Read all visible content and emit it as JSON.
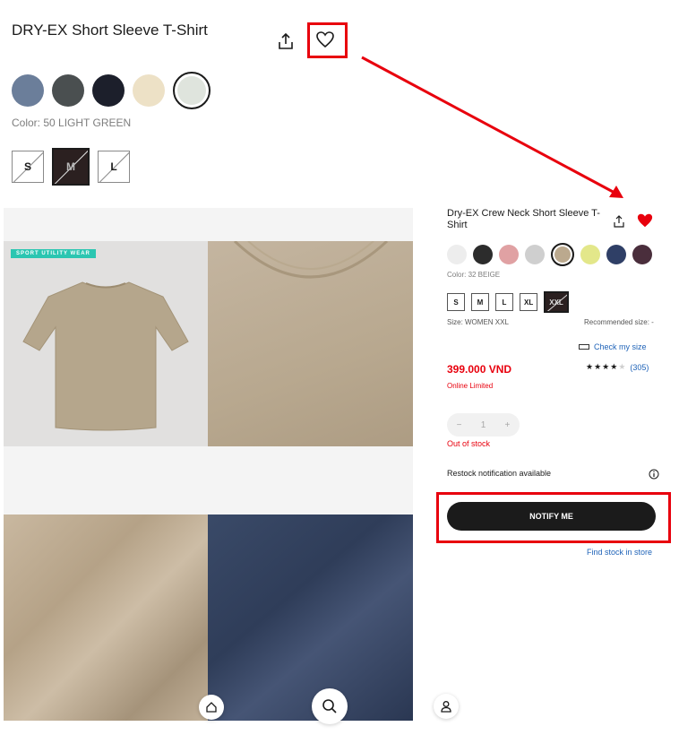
{
  "product": {
    "title": "DRY-EX Short Sleeve T-Shirt",
    "color_label": "Color: 50 LIGHT GREEN",
    "swatches": [
      {
        "color": "#6b7e9a",
        "selected": false
      },
      {
        "color": "#4a4f50",
        "selected": false
      },
      {
        "color": "#1c1f2b",
        "selected": false
      },
      {
        "color": "#ede1c6",
        "selected": false
      },
      {
        "color": "#dfe4dd",
        "selected": true
      }
    ],
    "sizes": [
      {
        "label": "S",
        "selected": false
      },
      {
        "label": "M",
        "selected": true
      },
      {
        "label": "L",
        "selected": false
      }
    ]
  },
  "gallery": {
    "tag": "SPORT UTILITY WEAR"
  },
  "mini": {
    "title": "Dry-EX Crew Neck Short Sleeve T-Shirt",
    "color_label": "Color: 32 BEIGE",
    "swatches": [
      {
        "color": "#ededed",
        "selected": false
      },
      {
        "color": "#2c2c2c",
        "selected": false
      },
      {
        "color": "#e0a1a3",
        "selected": false
      },
      {
        "color": "#cfcfcf",
        "selected": false
      },
      {
        "color": "#bba98e",
        "selected": true
      },
      {
        "color": "#e3e78a",
        "selected": false
      },
      {
        "color": "#2f3f66",
        "selected": false
      },
      {
        "color": "#4a2e3c",
        "selected": false
      }
    ],
    "sizes": [
      {
        "label": "S",
        "selected": false
      },
      {
        "label": "M",
        "selected": false
      },
      {
        "label": "L",
        "selected": false
      },
      {
        "label": "XL",
        "selected": false
      },
      {
        "label": "XXL",
        "selected": true
      }
    ],
    "size_label": "Size: WOMEN XXL",
    "recommended": "Recommended size: -",
    "check_size": "Check my size",
    "price": "399.000 VND",
    "stars": "★★★★★",
    "reviews": "(305)",
    "online_limited": "Online Limited",
    "qty_minus": "−",
    "qty_value": "1",
    "qty_plus": "+",
    "out_of_stock": "Out of stock",
    "restock": "Restock notification available",
    "notify_button": "NOTIFY ME",
    "find_stock": "Find stock in store"
  },
  "colors": {
    "accent_red": "#e8000d",
    "link_blue": "#1f63b8"
  }
}
